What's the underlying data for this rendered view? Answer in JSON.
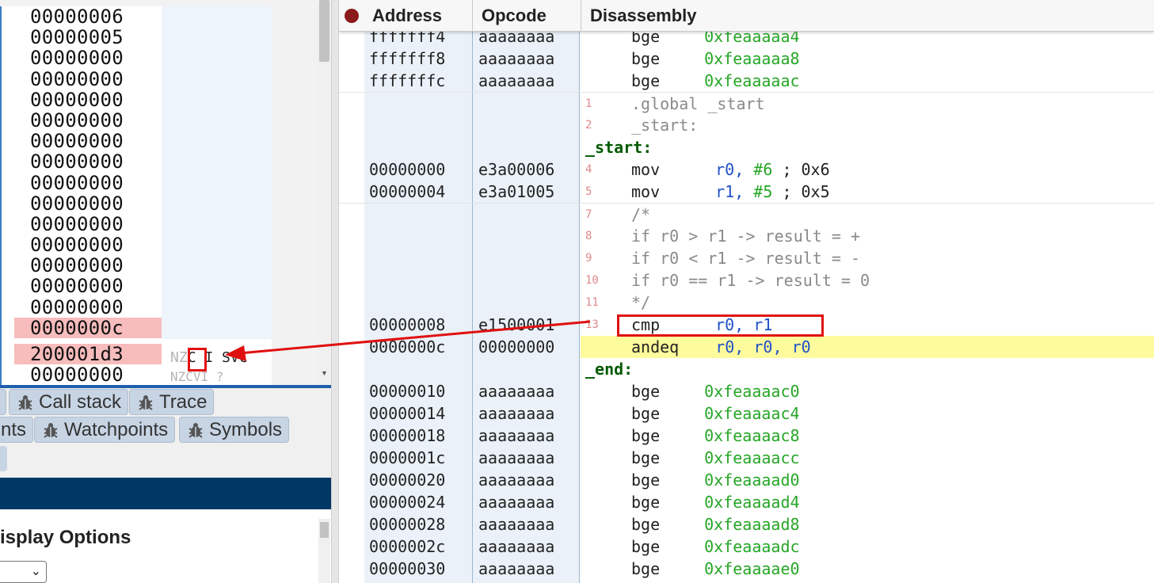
{
  "registers": {
    "values": [
      "00000006",
      "00000005",
      "00000000",
      "00000000",
      "00000000",
      "00000000",
      "00000000",
      "00000000",
      "00000000",
      "00000000",
      "00000000",
      "00000000",
      "00000000",
      "00000000",
      "00000000"
    ],
    "pc_value": "0000000c",
    "cpsr_value": "200001d3",
    "partial_value": "00000000",
    "flags_text": "NZCVI",
    "flags_prefix": "NZ",
    "flags_c": "C",
    "flags_rest": "I SVC",
    "flags_sub": "NZCVI   ?"
  },
  "tabs": {
    "call_stack": "Call stack",
    "trace": "Trace",
    "breakpoints_partial": "nts",
    "watchpoints": "Watchpoints",
    "symbols": "Symbols"
  },
  "display_options": {
    "title": "isplay Options"
  },
  "disassembly": {
    "headers": {
      "address": "Address",
      "opcode": "Opcode",
      "disassembly": "Disassembly"
    },
    "rows": [
      {
        "kind": "insn",
        "addr": "fffffff4",
        "op": "aaaaaaaa",
        "mn": "bge",
        "arg": "0xfeaaaaa4"
      },
      {
        "kind": "insn",
        "addr": "fffffff8",
        "op": "aaaaaaaa",
        "mn": "bge",
        "arg": "0xfeaaaaa8"
      },
      {
        "kind": "insn",
        "addr": "fffffffc",
        "op": "aaaaaaaa",
        "mn": "bge",
        "arg": "0xfeaaaaac"
      },
      {
        "kind": "src",
        "ln": "1",
        "text": ".global _start"
      },
      {
        "kind": "src",
        "ln": "2",
        "text": "_start:"
      },
      {
        "kind": "label",
        "text": "_start:"
      },
      {
        "kind": "mov",
        "addr": "00000000",
        "op": "e3a00006",
        "ln": "4",
        "mn": "mov",
        "r": "r0,",
        "imm": "#6",
        "cm": "; 0x6"
      },
      {
        "kind": "mov",
        "addr": "00000004",
        "op": "e3a01005",
        "ln": "5",
        "mn": "mov",
        "r": "r1,",
        "imm": "#5",
        "cm": "; 0x5"
      },
      {
        "kind": "src",
        "ln": "7",
        "text": "/*"
      },
      {
        "kind": "src",
        "ln": "8",
        "text": "if r0 > r1 -> result = +"
      },
      {
        "kind": "src",
        "ln": "9",
        "text": "if r0 < r1 -> result = -"
      },
      {
        "kind": "src",
        "ln": "10",
        "text": "if r0 == r1 -> result = 0"
      },
      {
        "kind": "src",
        "ln": "11",
        "text": "*/"
      },
      {
        "kind": "cmp",
        "addr": "00000008",
        "op": "e1500001",
        "ln": "13",
        "mn": "cmp",
        "r1": "r0,",
        "r2": "r1"
      },
      {
        "kind": "andeq",
        "addr": "0000000c",
        "op": "00000000",
        "mn": "andeq",
        "r1": "r0,",
        "r2": "r0,",
        "r3": "r0"
      },
      {
        "kind": "label",
        "text": "_end:"
      },
      {
        "kind": "insn",
        "addr": "00000010",
        "op": "aaaaaaaa",
        "mn": "bge",
        "arg": "0xfeaaaac0"
      },
      {
        "kind": "insn",
        "addr": "00000014",
        "op": "aaaaaaaa",
        "mn": "bge",
        "arg": "0xfeaaaac4"
      },
      {
        "kind": "insn",
        "addr": "00000018",
        "op": "aaaaaaaa",
        "mn": "bge",
        "arg": "0xfeaaaac8"
      },
      {
        "kind": "insn",
        "addr": "0000001c",
        "op": "aaaaaaaa",
        "mn": "bge",
        "arg": "0xfeaaaacc"
      },
      {
        "kind": "insn",
        "addr": "00000020",
        "op": "aaaaaaaa",
        "mn": "bge",
        "arg": "0xfeaaaad0"
      },
      {
        "kind": "insn",
        "addr": "00000024",
        "op": "aaaaaaaa",
        "mn": "bge",
        "arg": "0xfeaaaad4"
      },
      {
        "kind": "insn",
        "addr": "00000028",
        "op": "aaaaaaaa",
        "mn": "bge",
        "arg": "0xfeaaaad8"
      },
      {
        "kind": "insn",
        "addr": "0000002c",
        "op": "aaaaaaaa",
        "mn": "bge",
        "arg": "0xfeaaaadc"
      },
      {
        "kind": "insn",
        "addr": "00000030",
        "op": "aaaaaaaa",
        "mn": "bge",
        "arg": "0xfeaaaae0"
      }
    ]
  },
  "colors": {
    "highlight_row": "#fdfb9c",
    "register_highlight": "#f7bcbc",
    "annotation_red": "#e01010",
    "breakpoint": "#8b1a1a",
    "register_blue": "#2050c8",
    "number_green": "#26a626",
    "label_green": "#005a00"
  },
  "icons": {
    "breakpoint_dot": "breakpoint-icon",
    "tab_bug": "bug-icon",
    "dropdown": "chevron-down-icon"
  }
}
